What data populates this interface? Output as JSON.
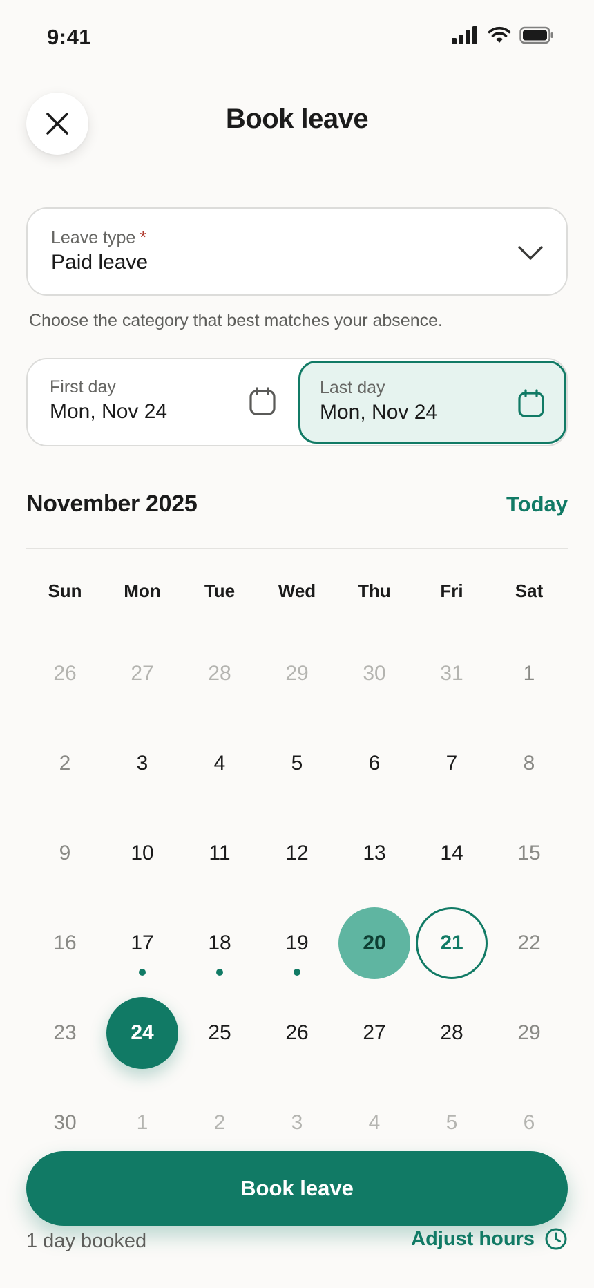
{
  "status_bar": {
    "time": "9:41"
  },
  "header": {
    "title": "Book leave"
  },
  "leave_type": {
    "label": "Leave type",
    "required_mark": "*",
    "value": "Paid leave"
  },
  "helper_text": "Choose the category that best matches your absence.",
  "date_range": {
    "first_label": "First day",
    "first_value": "Mon, Nov 24",
    "last_label": "Last day",
    "last_value": "Mon, Nov 24"
  },
  "calendar": {
    "month_label": "November 2025",
    "today_label": "Today",
    "weekdays": [
      "Sun",
      "Mon",
      "Tue",
      "Wed",
      "Thu",
      "Fri",
      "Sat"
    ],
    "days": [
      {
        "label": "26",
        "state": "outside"
      },
      {
        "label": "27",
        "state": "outside"
      },
      {
        "label": "28",
        "state": "outside"
      },
      {
        "label": "29",
        "state": "outside"
      },
      {
        "label": "30",
        "state": "outside"
      },
      {
        "label": "31",
        "state": "outside"
      },
      {
        "label": "1",
        "state": "weekend"
      },
      {
        "label": "2",
        "state": "weekend"
      },
      {
        "label": "3"
      },
      {
        "label": "4"
      },
      {
        "label": "5"
      },
      {
        "label": "6"
      },
      {
        "label": "7"
      },
      {
        "label": "8",
        "state": "weekend"
      },
      {
        "label": "9",
        "state": "weekend"
      },
      {
        "label": "10"
      },
      {
        "label": "11"
      },
      {
        "label": "12"
      },
      {
        "label": "13"
      },
      {
        "label": "14"
      },
      {
        "label": "15",
        "state": "weekend"
      },
      {
        "label": "16",
        "state": "weekend"
      },
      {
        "label": "17",
        "dot": true
      },
      {
        "label": "18",
        "dot": true
      },
      {
        "label": "19",
        "dot": true
      },
      {
        "label": "20",
        "state": "range-start"
      },
      {
        "label": "21",
        "state": "today-ring"
      },
      {
        "label": "22",
        "state": "weekend"
      },
      {
        "label": "23",
        "state": "weekend"
      },
      {
        "label": "24",
        "state": "selected"
      },
      {
        "label": "25"
      },
      {
        "label": "26"
      },
      {
        "label": "27"
      },
      {
        "label": "28"
      },
      {
        "label": "29",
        "state": "weekend"
      },
      {
        "label": "30",
        "state": "weekend"
      },
      {
        "label": "1",
        "state": "outside"
      },
      {
        "label": "2",
        "state": "outside"
      },
      {
        "label": "3",
        "state": "outside"
      },
      {
        "label": "4",
        "state": "outside"
      },
      {
        "label": "5",
        "state": "outside"
      },
      {
        "label": "6",
        "state": "outside"
      }
    ]
  },
  "footer": {
    "book_button": "Book leave",
    "summary": "1 day booked",
    "adjust_hours": "Adjust hours"
  },
  "colors": {
    "accent": "#117A65",
    "accent_soft": "#5FB5A1",
    "highlight_bg": "#E6F3EF",
    "required": "#B03A2E"
  }
}
